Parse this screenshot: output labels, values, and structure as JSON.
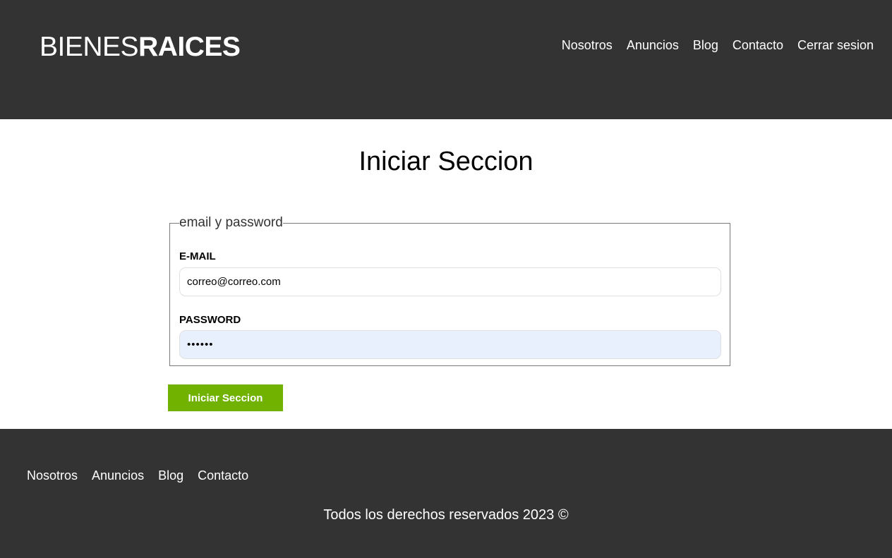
{
  "header": {
    "logo_light": "BIENES",
    "logo_bold": "RAICES",
    "nav": [
      "Nosotros",
      "Anuncios",
      "Blog",
      "Contacto",
      "Cerrar sesion"
    ]
  },
  "main": {
    "title": "Iniciar Seccion",
    "fieldset_legend": "email y password",
    "email_label": "E-MAIL",
    "email_value": "correo@correo.com",
    "password_label": "PASSWORD",
    "password_value": "••••••",
    "submit_label": "Iniciar Seccion"
  },
  "footer": {
    "nav": [
      "Nosotros",
      "Anuncios",
      "Blog",
      "Contacto"
    ],
    "copyright": "Todos los derechos reservados 2023 ©"
  },
  "colors": {
    "header_bg": "#333333",
    "button_bg": "#71b100",
    "password_bg": "#e8f0fe"
  }
}
